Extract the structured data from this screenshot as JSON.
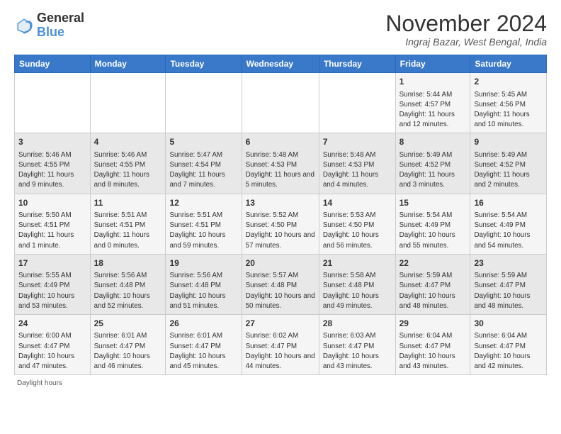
{
  "header": {
    "logo_general": "General",
    "logo_blue": "Blue",
    "month_title": "November 2024",
    "location": "Ingraj Bazar, West Bengal, India"
  },
  "weekdays": [
    "Sunday",
    "Monday",
    "Tuesday",
    "Wednesday",
    "Thursday",
    "Friday",
    "Saturday"
  ],
  "weeks": [
    [
      {
        "day": "",
        "info": ""
      },
      {
        "day": "",
        "info": ""
      },
      {
        "day": "",
        "info": ""
      },
      {
        "day": "",
        "info": ""
      },
      {
        "day": "",
        "info": ""
      },
      {
        "day": "1",
        "info": "Sunrise: 5:44 AM\nSunset: 4:57 PM\nDaylight: 11 hours and 12 minutes."
      },
      {
        "day": "2",
        "info": "Sunrise: 5:45 AM\nSunset: 4:56 PM\nDaylight: 11 hours and 10 minutes."
      }
    ],
    [
      {
        "day": "3",
        "info": "Sunrise: 5:46 AM\nSunset: 4:55 PM\nDaylight: 11 hours and 9 minutes."
      },
      {
        "day": "4",
        "info": "Sunrise: 5:46 AM\nSunset: 4:55 PM\nDaylight: 11 hours and 8 minutes."
      },
      {
        "day": "5",
        "info": "Sunrise: 5:47 AM\nSunset: 4:54 PM\nDaylight: 11 hours and 7 minutes."
      },
      {
        "day": "6",
        "info": "Sunrise: 5:48 AM\nSunset: 4:53 PM\nDaylight: 11 hours and 5 minutes."
      },
      {
        "day": "7",
        "info": "Sunrise: 5:48 AM\nSunset: 4:53 PM\nDaylight: 11 hours and 4 minutes."
      },
      {
        "day": "8",
        "info": "Sunrise: 5:49 AM\nSunset: 4:52 PM\nDaylight: 11 hours and 3 minutes."
      },
      {
        "day": "9",
        "info": "Sunrise: 5:49 AM\nSunset: 4:52 PM\nDaylight: 11 hours and 2 minutes."
      }
    ],
    [
      {
        "day": "10",
        "info": "Sunrise: 5:50 AM\nSunset: 4:51 PM\nDaylight: 11 hours and 1 minute."
      },
      {
        "day": "11",
        "info": "Sunrise: 5:51 AM\nSunset: 4:51 PM\nDaylight: 11 hours and 0 minutes."
      },
      {
        "day": "12",
        "info": "Sunrise: 5:51 AM\nSunset: 4:51 PM\nDaylight: 10 hours and 59 minutes."
      },
      {
        "day": "13",
        "info": "Sunrise: 5:52 AM\nSunset: 4:50 PM\nDaylight: 10 hours and 57 minutes."
      },
      {
        "day": "14",
        "info": "Sunrise: 5:53 AM\nSunset: 4:50 PM\nDaylight: 10 hours and 56 minutes."
      },
      {
        "day": "15",
        "info": "Sunrise: 5:54 AM\nSunset: 4:49 PM\nDaylight: 10 hours and 55 minutes."
      },
      {
        "day": "16",
        "info": "Sunrise: 5:54 AM\nSunset: 4:49 PM\nDaylight: 10 hours and 54 minutes."
      }
    ],
    [
      {
        "day": "17",
        "info": "Sunrise: 5:55 AM\nSunset: 4:49 PM\nDaylight: 10 hours and 53 minutes."
      },
      {
        "day": "18",
        "info": "Sunrise: 5:56 AM\nSunset: 4:48 PM\nDaylight: 10 hours and 52 minutes."
      },
      {
        "day": "19",
        "info": "Sunrise: 5:56 AM\nSunset: 4:48 PM\nDaylight: 10 hours and 51 minutes."
      },
      {
        "day": "20",
        "info": "Sunrise: 5:57 AM\nSunset: 4:48 PM\nDaylight: 10 hours and 50 minutes."
      },
      {
        "day": "21",
        "info": "Sunrise: 5:58 AM\nSunset: 4:48 PM\nDaylight: 10 hours and 49 minutes."
      },
      {
        "day": "22",
        "info": "Sunrise: 5:59 AM\nSunset: 4:47 PM\nDaylight: 10 hours and 48 minutes."
      },
      {
        "day": "23",
        "info": "Sunrise: 5:59 AM\nSunset: 4:47 PM\nDaylight: 10 hours and 48 minutes."
      }
    ],
    [
      {
        "day": "24",
        "info": "Sunrise: 6:00 AM\nSunset: 4:47 PM\nDaylight: 10 hours and 47 minutes."
      },
      {
        "day": "25",
        "info": "Sunrise: 6:01 AM\nSunset: 4:47 PM\nDaylight: 10 hours and 46 minutes."
      },
      {
        "day": "26",
        "info": "Sunrise: 6:01 AM\nSunset: 4:47 PM\nDaylight: 10 hours and 45 minutes."
      },
      {
        "day": "27",
        "info": "Sunrise: 6:02 AM\nSunset: 4:47 PM\nDaylight: 10 hours and 44 minutes."
      },
      {
        "day": "28",
        "info": "Sunrise: 6:03 AM\nSunset: 4:47 PM\nDaylight: 10 hours and 43 minutes."
      },
      {
        "day": "29",
        "info": "Sunrise: 6:04 AM\nSunset: 4:47 PM\nDaylight: 10 hours and 43 minutes."
      },
      {
        "day": "30",
        "info": "Sunrise: 6:04 AM\nSunset: 4:47 PM\nDaylight: 10 hours and 42 minutes."
      }
    ]
  ],
  "footer": {
    "note": "Daylight hours"
  }
}
